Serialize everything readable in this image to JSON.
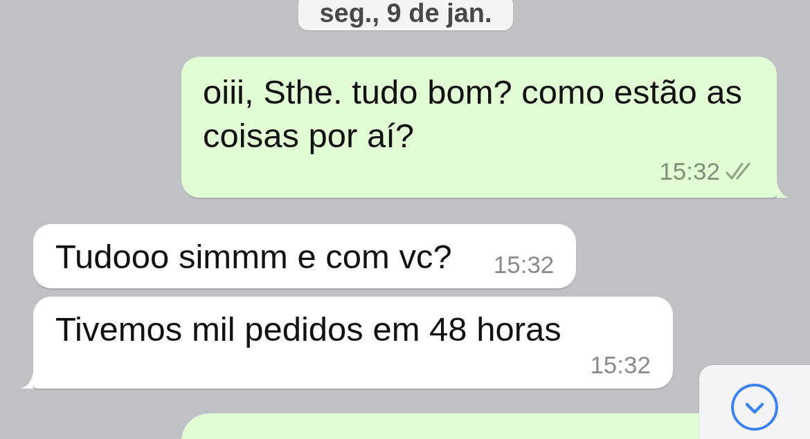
{
  "date_pill": "seg., 9 de jan.",
  "messages": [
    {
      "kind": "out",
      "text": "oiii, Sthe. tudo bom? como estão as coisas por aí?",
      "time": "15:32",
      "tail": true,
      "read": false
    },
    {
      "kind": "in",
      "text": "Tudooo simmm e com vc?",
      "time": "15:32",
      "tail": false
    },
    {
      "kind": "in",
      "text": "Tivemos mil pedidos em 48 horas",
      "time": "15:32",
      "tail": true
    }
  ]
}
